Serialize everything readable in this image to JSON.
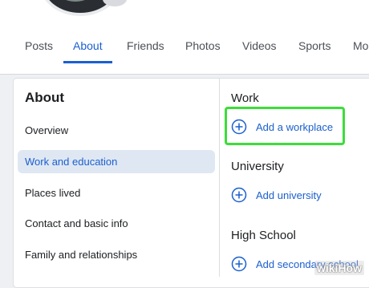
{
  "tabs": [
    {
      "label": "Posts"
    },
    {
      "label": "About"
    },
    {
      "label": "Friends"
    },
    {
      "label": "Photos"
    },
    {
      "label": "Videos"
    },
    {
      "label": "Sports"
    },
    {
      "label": "Mo"
    }
  ],
  "active_tab": "About",
  "sidebar": {
    "title": "About",
    "items": [
      {
        "label": "Overview"
      },
      {
        "label": "Work and education"
      },
      {
        "label": "Places lived"
      },
      {
        "label": "Contact and basic info"
      },
      {
        "label": "Family and relationships"
      }
    ],
    "active_item": "Work and education"
  },
  "sections": [
    {
      "title": "Work",
      "action": "Add a workplace"
    },
    {
      "title": "University",
      "action": "Add university"
    },
    {
      "title": "High School",
      "action": "Add secondary school"
    }
  ],
  "colors": {
    "accent": "#1b5fcf",
    "highlight": "#3ddc3a",
    "active_bg": "#dfe7f2"
  },
  "watermark": "wikiHow"
}
